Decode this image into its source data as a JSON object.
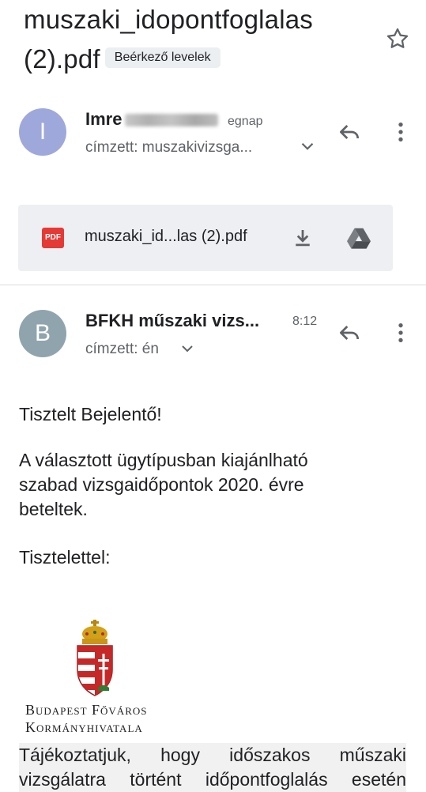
{
  "subject": {
    "line1": "muszaki_idopontfoglalas",
    "line2": "(2).pdf",
    "label": "Beérkező levelek"
  },
  "messages": [
    {
      "avatar_letter": "I",
      "avatar_color": "#9fa8da",
      "sender": "Imre",
      "time": "egnap",
      "recipient": "címzett: muszakivizsga..."
    },
    {
      "avatar_letter": "B",
      "avatar_color": "#90a4ae",
      "sender": "BFKH műszaki vizs...",
      "time": "8:12",
      "recipient": "címzett: én"
    }
  ],
  "attachment": {
    "badge": "PDF",
    "name": "muszaki_id...las (2).pdf"
  },
  "body": {
    "greeting": "Tisztelt Bejelentő!",
    "para_line1": "A választott ügytípusban kiajánlható",
    "para_line2": "szabad vizsgaidőpontok 2020. évre",
    "para_line3": "beteltek.",
    "closing": "Tisztelettel:",
    "logo_line1": "Budapest Főváros",
    "logo_line2": "Kormányhivatala",
    "notice_line1": "Tájékoztatjuk, hogy időszakos műszaki",
    "notice_line2": "vizsgálatra történt időpontfoglalás esetén"
  },
  "icons": {
    "star": "star-outline-icon",
    "reply": "reply-icon",
    "more": "more-vert-icon",
    "expand": "chevron-down-icon",
    "download": "download-icon",
    "drive": "drive-icon"
  },
  "colors": {
    "accent_pdf": "#e53935",
    "icon_gray": "#5f6368",
    "chip_bg": "#eceff1",
    "attachment_bg": "#eeeff2"
  }
}
